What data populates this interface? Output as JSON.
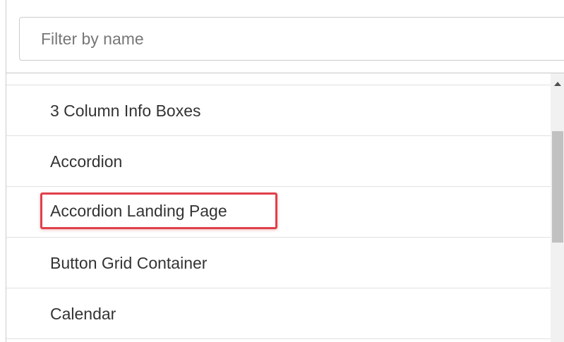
{
  "filter": {
    "placeholder": "Filter by name",
    "value": ""
  },
  "list": {
    "items": [
      {
        "label": "3 Column Info Boxes"
      },
      {
        "label": "Accordion"
      },
      {
        "label": "Accordion Landing Page",
        "highlighted": true
      },
      {
        "label": "Button Grid Container"
      },
      {
        "label": "Calendar"
      }
    ]
  },
  "colors": {
    "highlight_border": "#e0404a",
    "divider": "#e1e1e1",
    "text": "#333333"
  }
}
